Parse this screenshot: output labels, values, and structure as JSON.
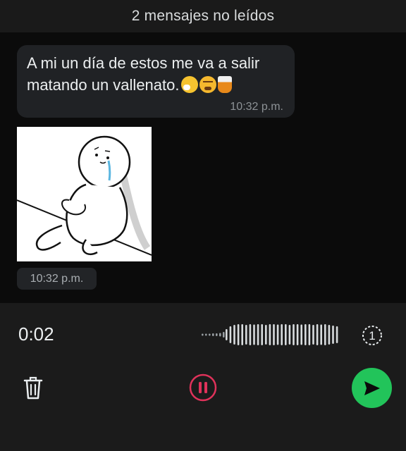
{
  "header": {
    "unread_label": "2 mensajes no leídos"
  },
  "messages": [
    {
      "text": "A mi un día de estos me va a salir matando un vallenato.",
      "emojis": [
        "sneezing-face-icon",
        "tired-face-icon",
        "tumbler-glass-icon"
      ],
      "time": "10:32 p.m."
    },
    {
      "sticker": "crying-cartoon-person-sticker",
      "time": "10:32 p.m."
    }
  ],
  "recorder": {
    "elapsed": "0:02",
    "playback_speed": "1",
    "icons": [
      "waveform-icon",
      "speed-icon",
      "trash-icon",
      "pause-icon",
      "send-icon"
    ],
    "colors": {
      "pause": "#e0325a",
      "send": "#22c45a"
    }
  }
}
